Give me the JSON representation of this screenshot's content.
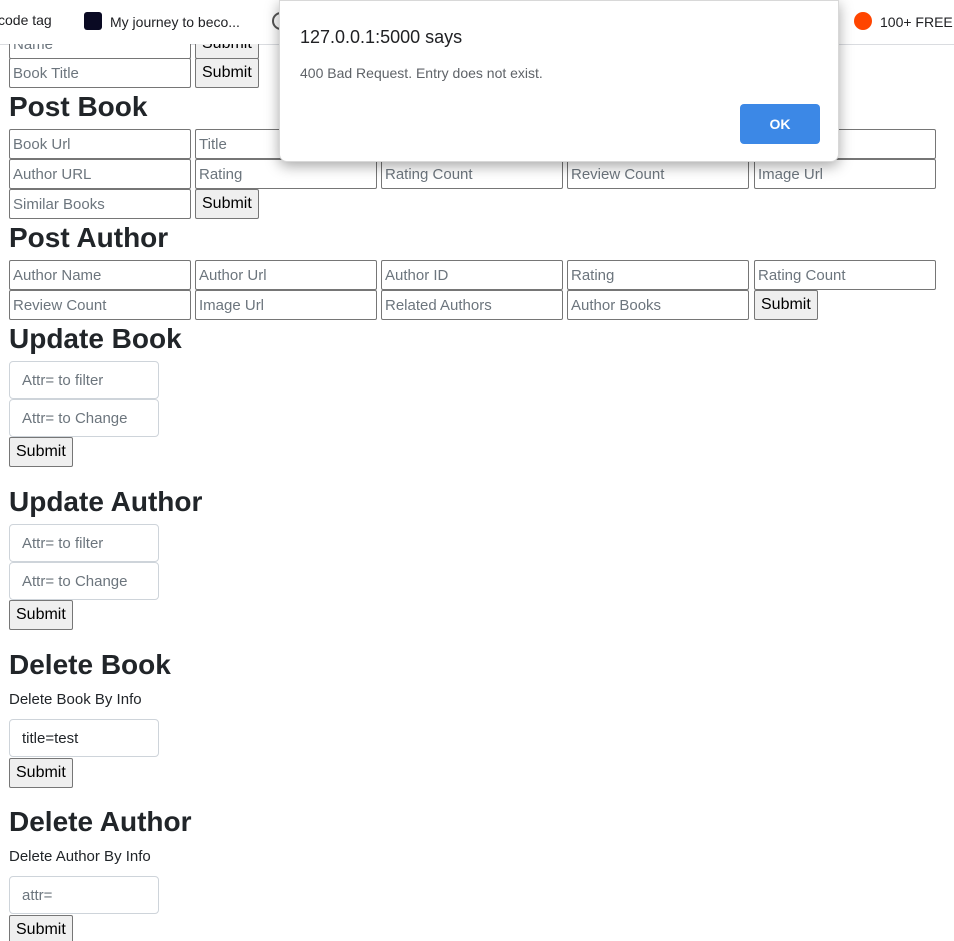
{
  "bookmarks": [
    {
      "label": "code tag",
      "icon": "bookmark-icon"
    },
    {
      "label": "My journey to beco...",
      "icon": "freecodecamp-icon"
    },
    {
      "label": "100+ FREE",
      "icon": "reddit-icon"
    }
  ],
  "partial_top": {
    "name_placeholder": "Name",
    "book_title_placeholder": "Book Title",
    "submit_label": "Submit"
  },
  "post_book": {
    "heading": "Post Book",
    "row1": [
      "Book Url",
      "Title"
    ],
    "row2": [
      "Author URL",
      "Rating",
      "Rating Count",
      "Review Count",
      "Image Url"
    ],
    "row3": [
      "Similar Books"
    ],
    "submit_label": "Submit"
  },
  "post_author": {
    "heading": "Post Author",
    "row1": [
      "Author Name",
      "Author Url",
      "Author ID",
      "Rating",
      "Rating Count"
    ],
    "row2": [
      "Review Count",
      "Image Url",
      "Related Authors",
      "Author Books"
    ],
    "submit_label": "Submit"
  },
  "update_book": {
    "heading": "Update Book",
    "filter_placeholder": "Attr= to filter",
    "change_placeholder": "Attr= to Change",
    "submit_label": "Submit"
  },
  "update_author": {
    "heading": "Update Author",
    "filter_placeholder": "Attr= to filter",
    "change_placeholder": "Attr= to Change",
    "submit_label": "Submit"
  },
  "delete_book": {
    "heading": "Delete Book",
    "label": "Delete Book By Info",
    "value": "title=test",
    "submit_label": "Submit"
  },
  "delete_author": {
    "heading": "Delete Author",
    "label": "Delete Author By Info",
    "placeholder": "attr=",
    "submit_label": "Submit"
  },
  "dialog": {
    "title": "127.0.0.1:5000 says",
    "message": "400 Bad Request. Entry does not exist.",
    "ok_label": "OK",
    "ok_color": "#3c88e6"
  }
}
